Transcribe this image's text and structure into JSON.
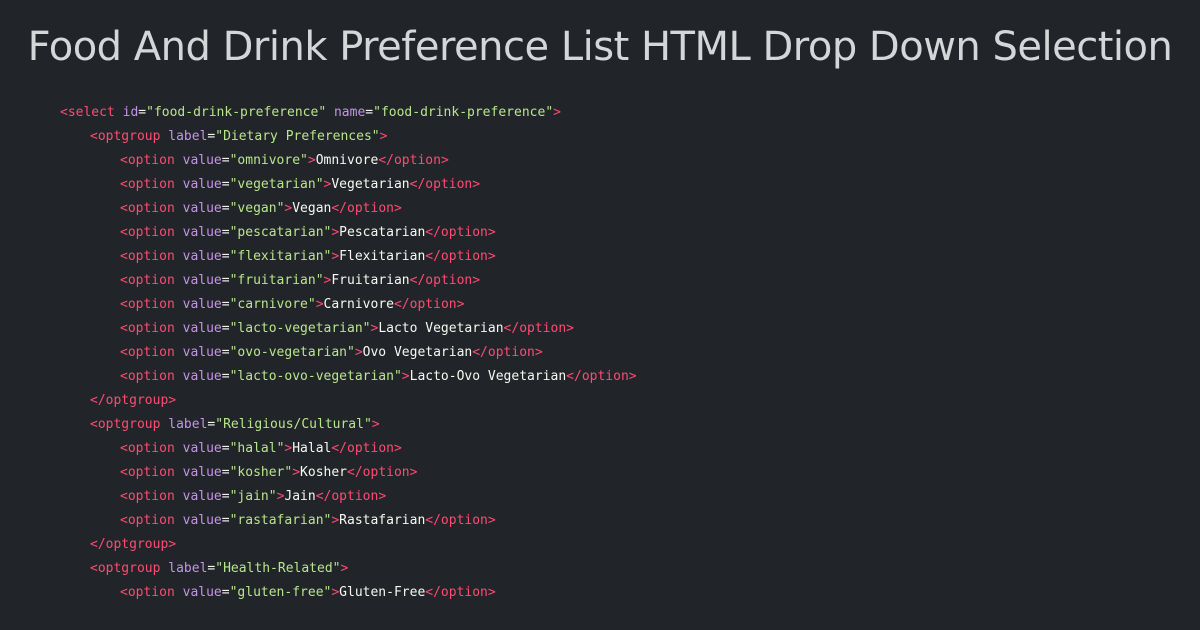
{
  "title": "Food And Drink Preference List HTML Drop Down Selection",
  "colors": {
    "background": "#212529",
    "title": "#d4d6d8",
    "tag": "#ff4a72",
    "attribute": "#c792ea",
    "string": "#b8e68a",
    "text": "#f8f8f2"
  },
  "code": {
    "select": {
      "id": "food-drink-preference",
      "name": "food-drink-preference"
    },
    "groups": [
      {
        "label": "Dietary Preferences",
        "options": [
          {
            "value": "omnivore",
            "text": "Omnivore"
          },
          {
            "value": "vegetarian",
            "text": "Vegetarian"
          },
          {
            "value": "vegan",
            "text": "Vegan"
          },
          {
            "value": "pescatarian",
            "text": "Pescatarian"
          },
          {
            "value": "flexitarian",
            "text": "Flexitarian"
          },
          {
            "value": "fruitarian",
            "text": "Fruitarian"
          },
          {
            "value": "carnivore",
            "text": "Carnivore"
          },
          {
            "value": "lacto-vegetarian",
            "text": "Lacto Vegetarian"
          },
          {
            "value": "ovo-vegetarian",
            "text": "Ovo Vegetarian"
          },
          {
            "value": "lacto-ovo-vegetarian",
            "text": "Lacto-Ovo Vegetarian"
          }
        ],
        "closed": true
      },
      {
        "label": "Religious/Cultural",
        "options": [
          {
            "value": "halal",
            "text": "Halal"
          },
          {
            "value": "kosher",
            "text": "Kosher"
          },
          {
            "value": "jain",
            "text": "Jain"
          },
          {
            "value": "rastafarian",
            "text": "Rastafarian"
          }
        ],
        "closed": true
      },
      {
        "label": "Health-Related",
        "options": [
          {
            "value": "gluten-free",
            "text": "Gluten-Free"
          }
        ],
        "closed": false
      }
    ]
  }
}
